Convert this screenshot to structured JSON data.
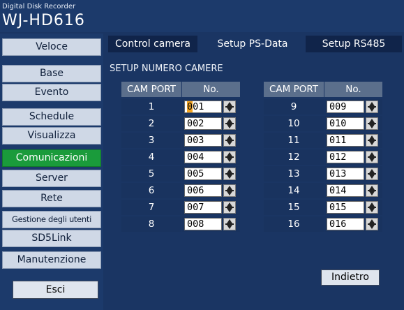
{
  "brand": {
    "subtitle": "Digital Disk Recorder",
    "model": "WJ-HD616"
  },
  "sidebar": {
    "items": [
      {
        "label": "Veloce",
        "active": false
      },
      {
        "label": "Base",
        "active": false
      },
      {
        "label": "Evento",
        "active": false
      },
      {
        "label": "Schedule",
        "active": false
      },
      {
        "label": "Visualizza",
        "active": false
      },
      {
        "label": "Comunicazioni",
        "active": true
      },
      {
        "label": "Server",
        "active": false
      },
      {
        "label": "Rete",
        "active": false
      },
      {
        "label": "Gestione degli utenti",
        "active": false
      },
      {
        "label": "SD5Link",
        "active": false
      },
      {
        "label": "Manutenzione",
        "active": false
      }
    ],
    "exit_label": "Esci"
  },
  "tabs": [
    {
      "label": "Control camera",
      "active": false
    },
    {
      "label": "Setup PS-Data",
      "active": true
    },
    {
      "label": "Setup RS485",
      "active": false
    }
  ],
  "section_title": "SETUP NUMERO CAMERE",
  "table": {
    "headers": {
      "port": "CAM PORT",
      "number": "No."
    },
    "rows": [
      {
        "port": "1",
        "number": "001"
      },
      {
        "port": "2",
        "number": "002"
      },
      {
        "port": "3",
        "number": "003"
      },
      {
        "port": "4",
        "number": "004"
      },
      {
        "port": "5",
        "number": "005"
      },
      {
        "port": "6",
        "number": "006"
      },
      {
        "port": "7",
        "number": "007"
      },
      {
        "port": "8",
        "number": "008"
      },
      {
        "port": "9",
        "number": "009"
      },
      {
        "port": "10",
        "number": "010"
      },
      {
        "port": "11",
        "number": "011"
      },
      {
        "port": "12",
        "number": "012"
      },
      {
        "port": "13",
        "number": "013"
      },
      {
        "port": "14",
        "number": "014"
      },
      {
        "port": "15",
        "number": "015"
      },
      {
        "port": "16",
        "number": "016"
      }
    ]
  },
  "back_label": "Indietro",
  "colors": {
    "background": "#1a3563",
    "active": "#1a9b3b",
    "cursor": "#f5a623",
    "header": "#5b6f8c"
  }
}
